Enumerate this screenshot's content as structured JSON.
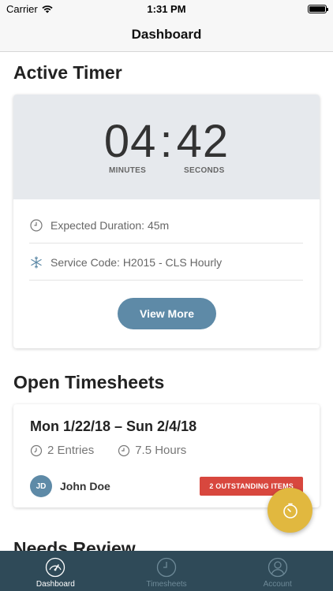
{
  "status_bar": {
    "carrier": "Carrier",
    "time": "1:31 PM"
  },
  "nav": {
    "title": "Dashboard"
  },
  "active_timer": {
    "section_title": "Active Timer",
    "minutes": "04",
    "separator": ":",
    "seconds": "42",
    "minutes_label": "MINUTES",
    "seconds_label": "SECONDS",
    "expected_duration": "Expected Duration: 45m",
    "service_code": "Service Code: H2015 - CLS Hourly",
    "view_more_label": "View More"
  },
  "open_timesheets": {
    "section_title": "Open Timesheets",
    "range": "Mon 1/22/18 – Sun 2/4/18",
    "entries": "2 Entries",
    "hours": "7.5 Hours",
    "user_initials": "JD",
    "user_name": "John Doe",
    "outstanding": "2 OUTSTANDING ITEMS"
  },
  "needs_review": {
    "section_title": "Needs Review"
  },
  "tabs": [
    {
      "label": "Dashboard",
      "icon": "speedometer-icon"
    },
    {
      "label": "Timesheets",
      "icon": "clock-icon"
    },
    {
      "label": "Account",
      "icon": "user-icon"
    }
  ],
  "colors": {
    "accent": "#5e8aa7",
    "fab": "#e1b83f",
    "alert": "#d8473e",
    "tab_bar": "#2f4a58"
  }
}
